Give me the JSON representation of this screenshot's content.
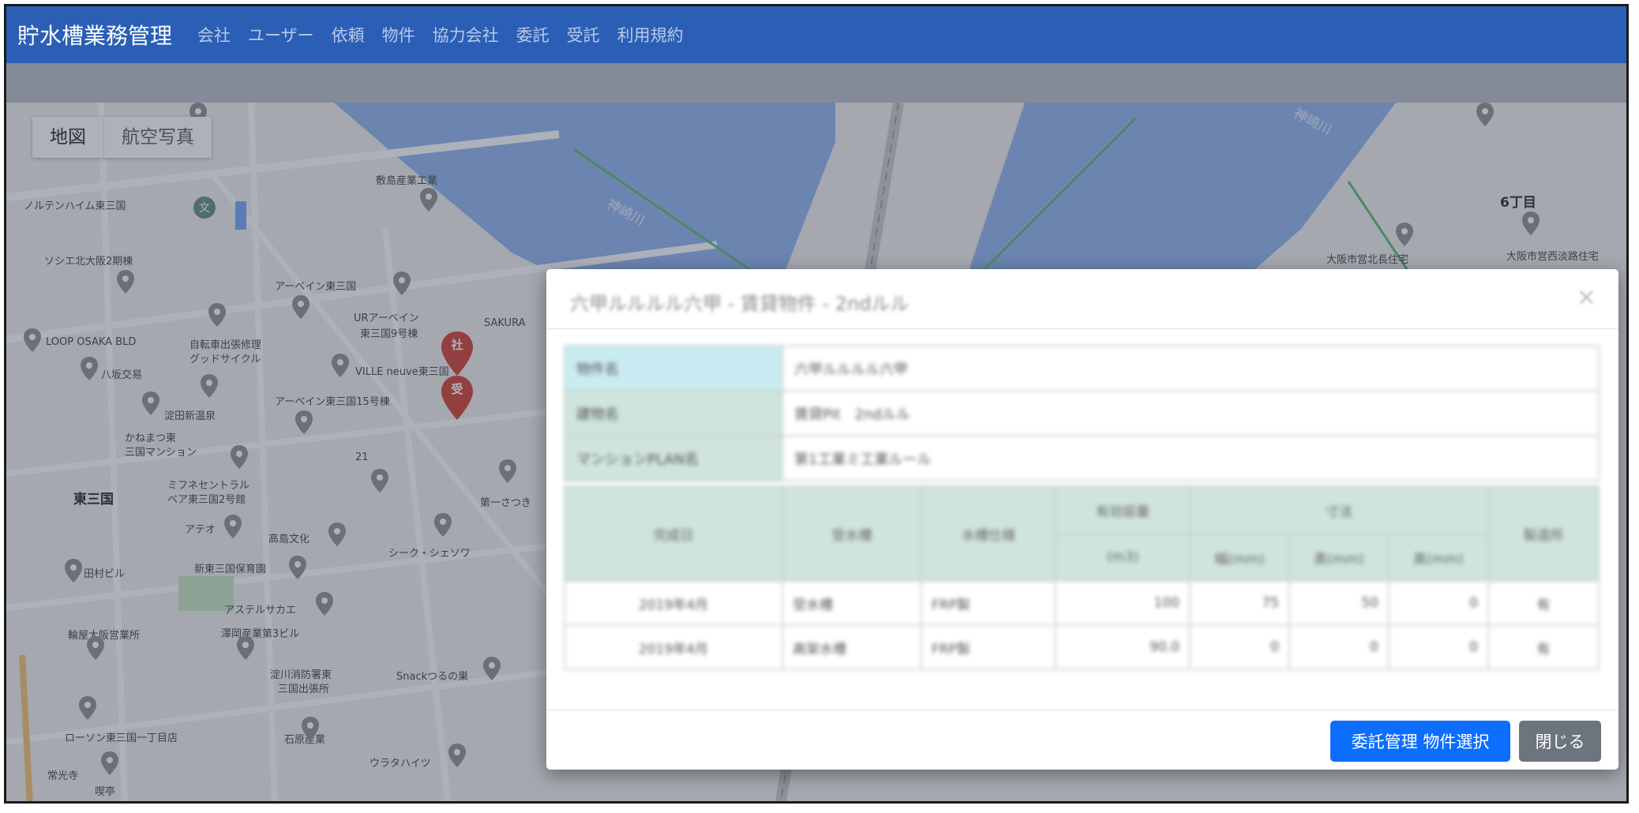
{
  "navbar": {
    "brand": "貯水槽業務管理",
    "links": [
      "会社",
      "ユーザー",
      "依頼",
      "物件",
      "協力会社",
      "委託",
      "受託",
      "利用規約"
    ]
  },
  "map": {
    "type_buttons": [
      "地図",
      "航空写真"
    ],
    "river_labels": [
      "神崎川",
      "神崎川"
    ],
    "pin_markers": [
      "社",
      "受"
    ],
    "place_labels": [
      "敷島産業工業",
      "ノルテンハイム東三国",
      "ソシエ北大阪2期棟",
      "アーベイン東三国",
      "URアーベイン",
      "東三国9号棟",
      "SAKURA",
      "LOOP OSAKA BLD",
      "自転車出張修理",
      "グッドサイクル",
      "八坂交易",
      "VILLE neuve東三国",
      "アーベイン東三国15号棟",
      "淀田新温泉",
      "かねまつ東",
      "三国マンション",
      "東三国",
      "ミフネセントラル",
      "ベア東三国2号館",
      "アテオ",
      "高島文化",
      "第一さつき",
      "シーク・シェソワ",
      "田村ビル",
      "新東三国保育園",
      "アステルサカエ",
      "輪屋大阪営業所",
      "澤岡産業第3ビル",
      "淀川消防署東",
      "三国出張所",
      "Snackつるの巣",
      "ローソン東三国一丁目店",
      "石原産業",
      "ウラタハイツ",
      "常光寺",
      "喫亭",
      "6丁目",
      "大阪市営北長住宅",
      "大阪市営西淡路住宅",
      "21"
    ]
  },
  "modal": {
    "title": "六甲ルルルル六甲 - 賃貸物件 - 2ndルル",
    "close_label": "×",
    "info_rows": [
      {
        "label": "物件名",
        "value": "六甲ルルルル六甲"
      },
      {
        "label": "建物名",
        "value": "賃貸Pit　2ndルル"
      },
      {
        "label": "マンションPLAN名",
        "value": "第1工業ミ工業ルール"
      }
    ],
    "grid_headers": [
      "完成日",
      "受水槽",
      "水槽仕様",
      "有効容量",
      "寸法",
      "製造所"
    ],
    "grid_subheaders": [
      "(m3)",
      "幅(mm)",
      "奥(mm)",
      "高(mm)"
    ],
    "grid_rows": [
      [
        "2019年4月",
        "受水槽",
        "FRP製",
        "100",
        "75",
        "50",
        "0",
        "有"
      ],
      [
        "2019年4月",
        "高架水槽",
        "FRP製",
        "90.0",
        "0",
        "0",
        "0",
        "有"
      ]
    ],
    "primary_button": "委託管理 物件選択",
    "close_button": "閉じる"
  }
}
